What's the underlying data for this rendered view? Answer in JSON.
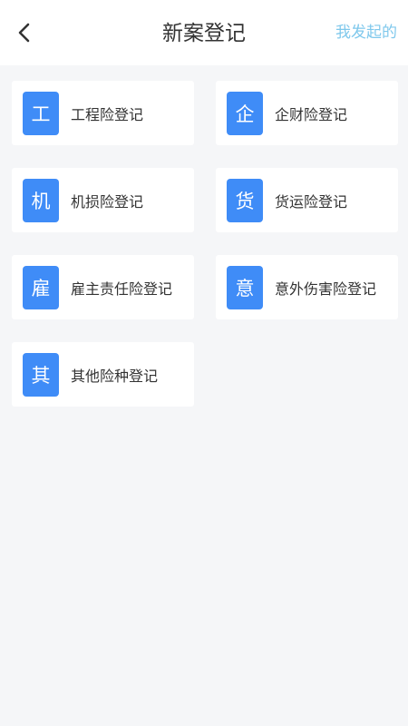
{
  "header": {
    "back_icon": "chevron-left-icon",
    "title": "新案登记",
    "action_label": "我发起的",
    "action_color": "#7fc8ec"
  },
  "theme": {
    "icon_bg": "#3f8cf7",
    "page_bg": "#f5f6f8"
  },
  "items": [
    {
      "icon_char": "工",
      "label": "工程险登记"
    },
    {
      "icon_char": "企",
      "label": "企财险登记"
    },
    {
      "icon_char": "机",
      "label": "机损险登记"
    },
    {
      "icon_char": "货",
      "label": "货运险登记"
    },
    {
      "icon_char": "雇",
      "label": "雇主责任险登记"
    },
    {
      "icon_char": "意",
      "label": "意外伤害险登记"
    },
    {
      "icon_char": "其",
      "label": "其他险种登记"
    }
  ]
}
